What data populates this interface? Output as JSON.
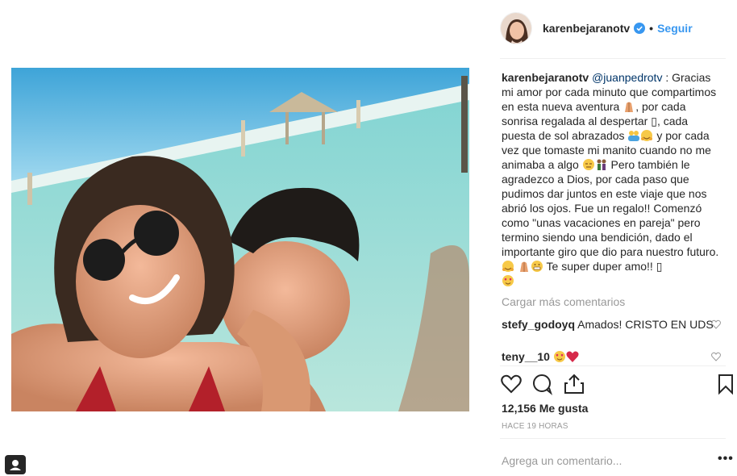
{
  "post": {
    "author": "karenbejaranotv",
    "follow_label": "Seguir",
    "separator": "•"
  },
  "caption": {
    "author": "karenbejaranotv",
    "mention": "@juanpedrotv",
    "text_1": " : Gracias mi amor por cada minuto que compartimos en esta nueva aventura ",
    "text_2": ", por cada sonrisa regalada al despertar ",
    "text_3": ", cada puesta de sol abrazados ",
    "text_4": " y por cada vez que tomaste mi manito cuando no me animaba a algo ",
    "text_5": " Pero también le agradezco a Dios, por cada paso que pudimos dar juntos en este viaje que nos abrió los ojos. Fue un regalo!! Comenzó como \"unas vacaciones en pareja\" pero termino siendo una bendición, dado el importante giro que dio para nuestro futuro. ",
    "text_6": " Te super duper amo!! ",
    "placeholder_glyph": "▯"
  },
  "load_more": "Cargar más comentarios",
  "comments": [
    {
      "user": "stefy_godoyq",
      "text": "Amados! CRISTO EN UDS"
    },
    {
      "user": "teny__10",
      "text": ""
    }
  ],
  "likes": "12,156 Me gusta",
  "time": "HACE 19 HORAS",
  "add_comment_placeholder": "Agrega un comentario...",
  "more_options": "•••",
  "icons": {
    "like": "heart-icon",
    "comment": "comment-icon",
    "share": "share-icon",
    "save": "bookmark-icon",
    "verified": "verified-badge-icon",
    "gallery": "gallery-icon"
  },
  "colors": {
    "link": "#3897f0",
    "mention": "#003569",
    "muted": "#999999",
    "text": "#262626",
    "verified": "#3897f0"
  }
}
